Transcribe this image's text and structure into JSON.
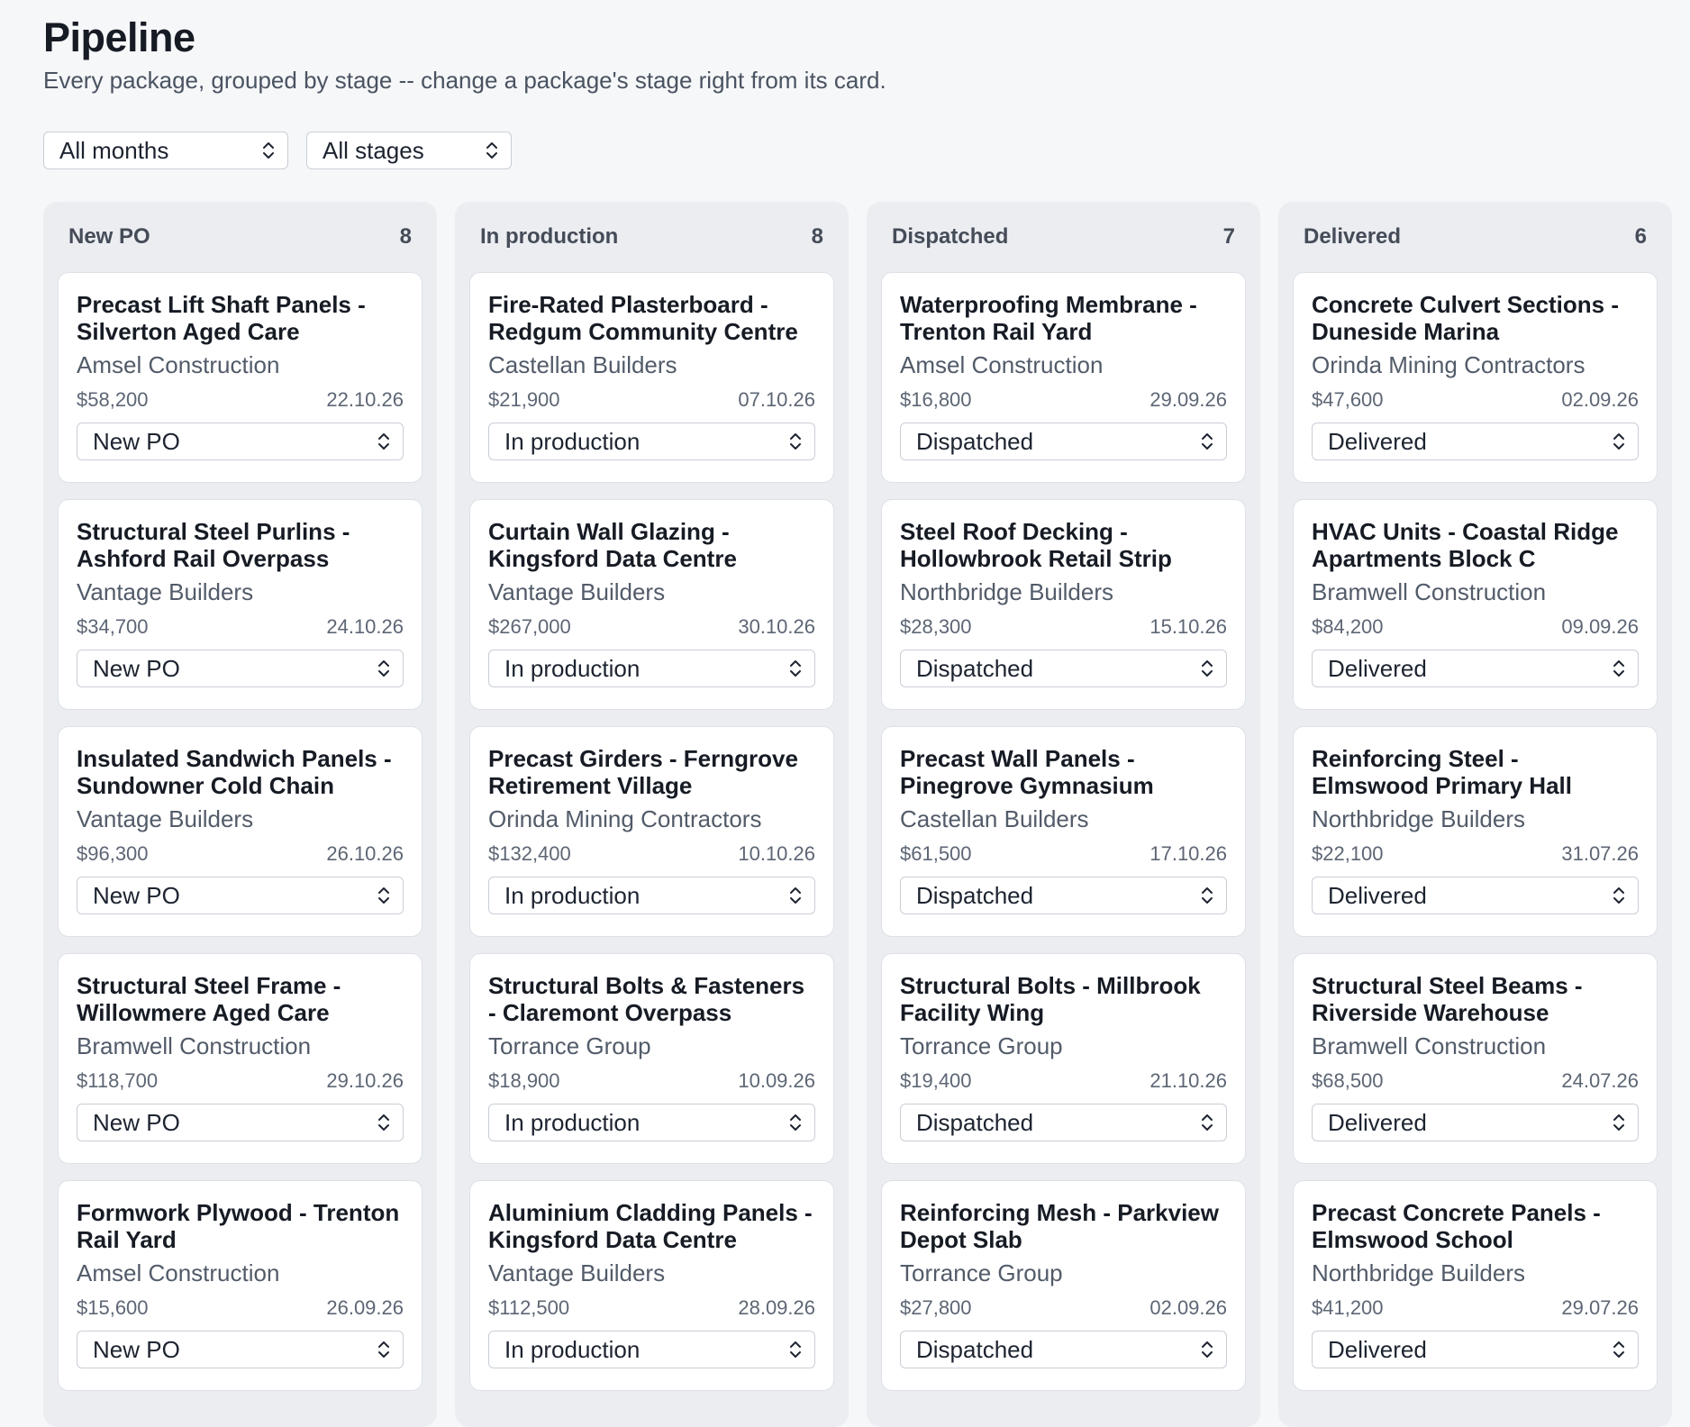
{
  "header": {
    "title": "Pipeline",
    "subtitle": "Every package, grouped by stage -- change a package's stage right from its card."
  },
  "filters": {
    "month": "All months",
    "stage": "All stages"
  },
  "columns": [
    {
      "name": "New PO",
      "count": "8",
      "cards": [
        {
          "title": "Precast Lift Shaft Panels - Silverton Aged Care",
          "client": "Amsel Construction",
          "amount": "$58,200",
          "date": "22.10.26",
          "stage": "New PO"
        },
        {
          "title": "Structural Steel Purlins - Ashford Rail Overpass",
          "client": "Vantage Builders",
          "amount": "$34,700",
          "date": "24.10.26",
          "stage": "New PO"
        },
        {
          "title": "Insulated Sandwich Panels - Sundowner Cold Chain",
          "client": "Vantage Builders",
          "amount": "$96,300",
          "date": "26.10.26",
          "stage": "New PO"
        },
        {
          "title": "Structural Steel Frame - Willowmere Aged Care",
          "client": "Bramwell Construction",
          "amount": "$118,700",
          "date": "29.10.26",
          "stage": "New PO"
        },
        {
          "title": "Formwork Plywood - Trenton Rail Yard",
          "client": "Amsel Construction",
          "amount": "$15,600",
          "date": "26.09.26",
          "stage": "New PO"
        }
      ]
    },
    {
      "name": "In production",
      "count": "8",
      "cards": [
        {
          "title": "Fire-Rated Plasterboard - Redgum Community Centre",
          "client": "Castellan Builders",
          "amount": "$21,900",
          "date": "07.10.26",
          "stage": "In production"
        },
        {
          "title": "Curtain Wall Glazing - Kingsford Data Centre",
          "client": "Vantage Builders",
          "amount": "$267,000",
          "date": "30.10.26",
          "stage": "In production"
        },
        {
          "title": "Precast Girders - Ferngrove Retirement Village",
          "client": "Orinda Mining Contractors",
          "amount": "$132,400",
          "date": "10.10.26",
          "stage": "In production"
        },
        {
          "title": "Structural Bolts & Fasteners - Claremont Overpass",
          "client": "Torrance Group",
          "amount": "$18,900",
          "date": "10.09.26",
          "stage": "In production"
        },
        {
          "title": "Aluminium Cladding Panels - Kingsford Data Centre",
          "client": "Vantage Builders",
          "amount": "$112,500",
          "date": "28.09.26",
          "stage": "In production"
        }
      ]
    },
    {
      "name": "Dispatched",
      "count": "7",
      "cards": [
        {
          "title": "Waterproofing Membrane - Trenton Rail Yard",
          "client": "Amsel Construction",
          "amount": "$16,800",
          "date": "29.09.26",
          "stage": "Dispatched"
        },
        {
          "title": "Steel Roof Decking - Hollowbrook Retail Strip",
          "client": "Northbridge Builders",
          "amount": "$28,300",
          "date": "15.10.26",
          "stage": "Dispatched"
        },
        {
          "title": "Precast Wall Panels - Pinegrove Gymnasium",
          "client": "Castellan Builders",
          "amount": "$61,500",
          "date": "17.10.26",
          "stage": "Dispatched"
        },
        {
          "title": "Structural Bolts - Millbrook Facility Wing",
          "client": "Torrance Group",
          "amount": "$19,400",
          "date": "21.10.26",
          "stage": "Dispatched"
        },
        {
          "title": "Reinforcing Mesh - Parkview Depot Slab",
          "client": "Torrance Group",
          "amount": "$27,800",
          "date": "02.09.26",
          "stage": "Dispatched"
        }
      ]
    },
    {
      "name": "Delivered",
      "count": "6",
      "cards": [
        {
          "title": "Concrete Culvert Sections - Duneside Marina",
          "client": "Orinda Mining Contractors",
          "amount": "$47,600",
          "date": "02.09.26",
          "stage": "Delivered"
        },
        {
          "title": "HVAC Units - Coastal Ridge Apartments Block C",
          "client": "Bramwell Construction",
          "amount": "$84,200",
          "date": "09.09.26",
          "stage": "Delivered"
        },
        {
          "title": "Reinforcing Steel - Elmswood Primary Hall",
          "client": "Northbridge Builders",
          "amount": "$22,100",
          "date": "31.07.26",
          "stage": "Delivered"
        },
        {
          "title": "Structural Steel Beams - Riverside Warehouse",
          "client": "Bramwell Construction",
          "amount": "$68,500",
          "date": "24.07.26",
          "stage": "Delivered"
        },
        {
          "title": "Precast Concrete Panels - Elmswood School",
          "client": "Northbridge Builders",
          "amount": "$41,200",
          "date": "29.07.26",
          "stage": "Delivered"
        }
      ]
    }
  ]
}
